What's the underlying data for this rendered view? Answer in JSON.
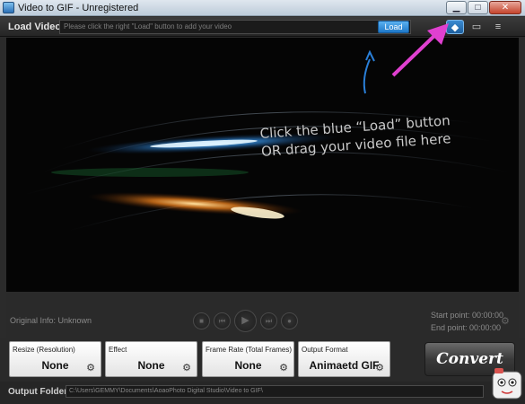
{
  "window": {
    "title": "Video to GIF - Unregistered"
  },
  "window_controls": {
    "minimize": "▁",
    "maximize": "□",
    "close": "✕"
  },
  "load_row": {
    "label": "Load Video:",
    "path_placeholder": "Please click the right \"Load\" button to add your video",
    "load_button": "Load",
    "tools": [
      {
        "name": "tag-icon",
        "glyph": "◆",
        "active": true
      },
      {
        "name": "chat-icon",
        "glyph": "▭"
      },
      {
        "name": "list-icon",
        "glyph": "≡"
      }
    ]
  },
  "video": {
    "hint_line1": "Click the blue “Load” button",
    "hint_line2": "OR drag your video file here"
  },
  "playback": {
    "original_info": "Original Info: Unknown",
    "controls": [
      {
        "name": "stop-button",
        "glyph": "■"
      },
      {
        "name": "prev-button",
        "glyph": "⏮"
      },
      {
        "name": "play-button",
        "glyph": "▶"
      },
      {
        "name": "next-button",
        "glyph": "⏭"
      },
      {
        "name": "snapshot-button",
        "glyph": "●"
      }
    ],
    "start_point": "Start point: 00:00:00",
    "end_point": "End point: 00:00:00"
  },
  "settings": [
    {
      "title": "Resize (Resolution)",
      "value": "None"
    },
    {
      "title": "Effect",
      "value": "None"
    },
    {
      "title": "Frame Rate (Total Frames)",
      "value": "None"
    },
    {
      "title": "Output Format",
      "value": "Animaetd GIF"
    }
  ],
  "convert_label": "Convert",
  "output": {
    "label": "Output Folder:",
    "path": "C:\\Users\\GEMMY\\Documents\\AoaoPhoto Digital Studio\\Video to GIF\\"
  },
  "colors": {
    "accent": "#2f8fe0",
    "annotation_arrow": "#e040d0"
  }
}
